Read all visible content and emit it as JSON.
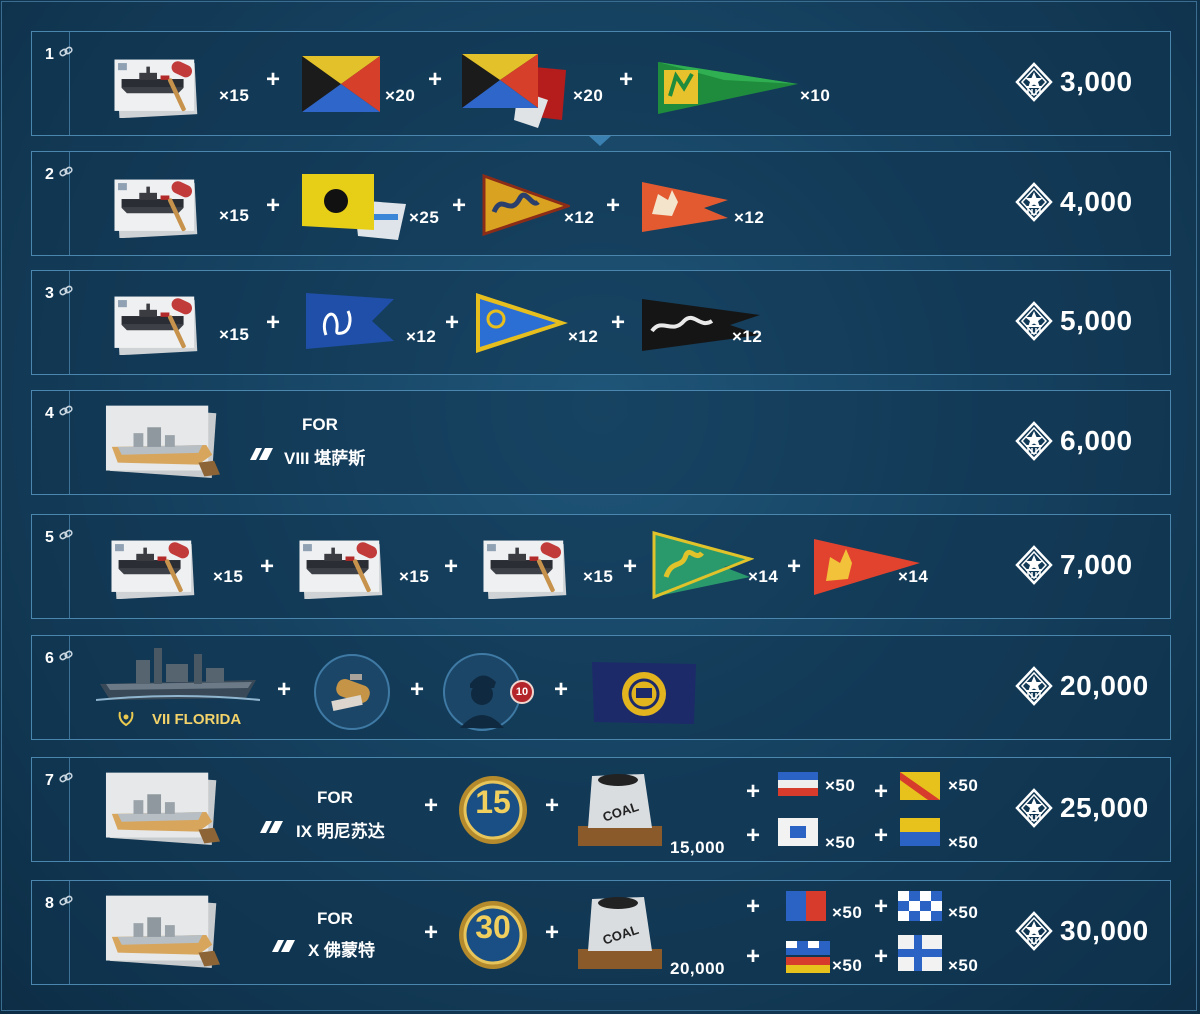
{
  "currency_icon": "coal-currency-icon",
  "rows": [
    {
      "num": "1",
      "price": "3,000",
      "items": [
        {
          "icon": "camouflage-card-icon",
          "qty": "×15"
        },
        {
          "icon": "signal-flag-zulu-icon",
          "qty": "×20"
        },
        {
          "icon": "signal-flags-bundle-icon",
          "qty": "×20"
        },
        {
          "icon": "green-pennant-icon",
          "qty": "×10"
        }
      ]
    },
    {
      "num": "2",
      "price": "4,000",
      "items": [
        {
          "icon": "camouflage-card-icon",
          "qty": "×15"
        },
        {
          "icon": "signal-flag-yellow-dot-icon",
          "qty": "×25"
        },
        {
          "icon": "dragon-pennant-yellow-icon",
          "qty": "×12"
        },
        {
          "icon": "lion-pennant-red-icon",
          "qty": "×12"
        }
      ]
    },
    {
      "num": "3",
      "price": "5,000",
      "items": [
        {
          "icon": "camouflage-card-icon",
          "qty": "×15"
        },
        {
          "icon": "blue-swallowtail-flag-icon",
          "qty": "×12"
        },
        {
          "icon": "blue-yellow-pennant-icon",
          "qty": "×12"
        },
        {
          "icon": "black-dragon-pennant-icon",
          "qty": "×12"
        }
      ]
    },
    {
      "num": "4",
      "price": "6,000",
      "for_label": "FOR",
      "ship": "VIII  堪萨斯"
    },
    {
      "num": "5",
      "price": "7,000",
      "items": [
        {
          "icon": "camouflage-card-icon",
          "qty": "×15"
        },
        {
          "icon": "camouflage-card-icon",
          "qty": "×15"
        },
        {
          "icon": "camouflage-card-icon",
          "qty": "×15"
        },
        {
          "icon": "green-dragon-pennant-icon",
          "qty": "×14"
        },
        {
          "icon": "red-lion-pennant-icon",
          "qty": "×14"
        }
      ]
    },
    {
      "num": "6",
      "price": "20,000",
      "ship_label": "VII  FLORIDA",
      "commander_badge": "10"
    },
    {
      "num": "7",
      "price": "25,000",
      "for_label": "FOR",
      "ship": "IX  明尼苏达",
      "medal": "15",
      "coal": "15,000",
      "signals": [
        "×50",
        "×50",
        "×50",
        "×50"
      ]
    },
    {
      "num": "8",
      "price": "30,000",
      "for_label": "FOR",
      "ship": "X  佛蒙特",
      "medal": "30",
      "coal": "20,000",
      "signals": [
        "×50",
        "×50",
        "×50",
        "×50"
      ]
    }
  ],
  "coal_bag_label": "COAL",
  "plus": "+"
}
